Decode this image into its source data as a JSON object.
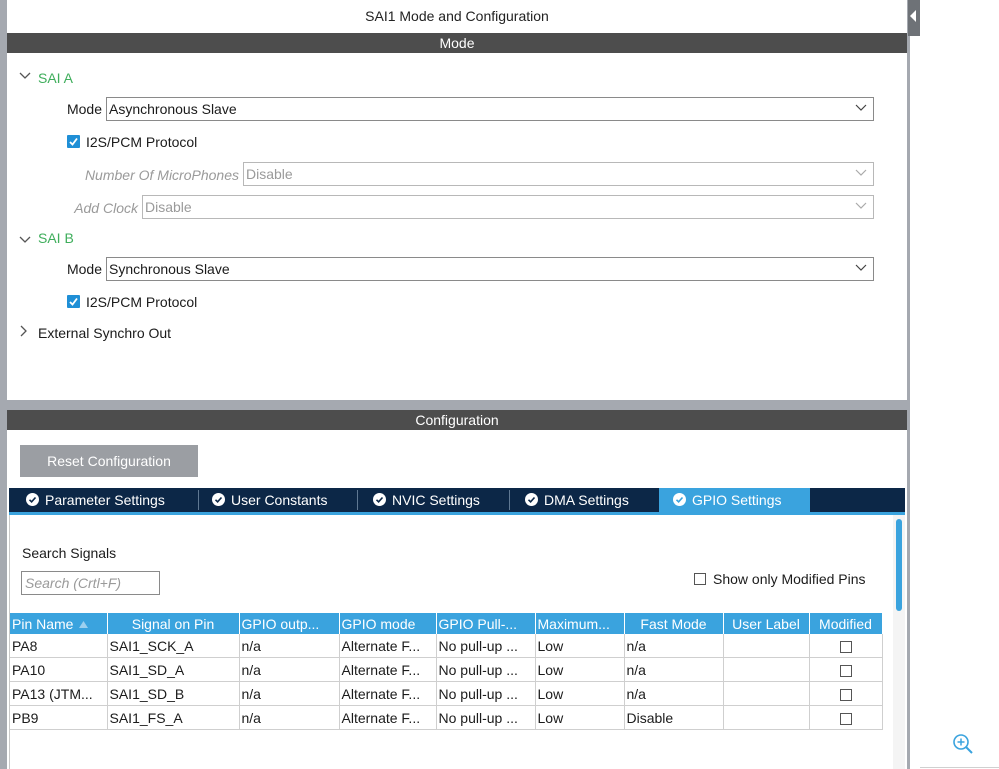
{
  "window": {
    "title": "SAI1 Mode and Configuration"
  },
  "mode_section": {
    "header": "Mode",
    "sai_a": {
      "label": "SAI A",
      "mode_label": "Mode",
      "mode_value": "Asynchronous Slave",
      "protocol_label": "I2S/PCM Protocol",
      "protocol_checked": true,
      "microphones_label": "Number Of MicroPhones",
      "microphones_value": "Disable",
      "add_clock_label": "Add Clock",
      "add_clock_value": "Disable"
    },
    "sai_b": {
      "label": "SAI B",
      "mode_label": "Mode",
      "mode_value": "Synchronous Slave",
      "protocol_label": "I2S/PCM Protocol",
      "protocol_checked": true
    },
    "external_synchro": {
      "label": "External Synchro Out"
    }
  },
  "configuration_section": {
    "header": "Configuration",
    "reset_label": "Reset Configuration",
    "tabs": [
      {
        "label": "Parameter Settings",
        "active": false
      },
      {
        "label": "User Constants",
        "active": false
      },
      {
        "label": "NVIC Settings",
        "active": false
      },
      {
        "label": "DMA Settings",
        "active": false
      },
      {
        "label": "GPIO Settings",
        "active": true
      }
    ],
    "search": {
      "label": "Search Signals",
      "placeholder": "Search (Crtl+F)"
    },
    "show_modified_label": "Show only Modified Pins",
    "table": {
      "columns": [
        "Pin Name",
        "Signal on Pin",
        "GPIO outp...",
        "GPIO mode",
        "GPIO Pull-...",
        "Maximum...",
        "Fast Mode",
        "User Label",
        "Modified"
      ],
      "rows": [
        [
          "PA8",
          "SAI1_SCK_A",
          "n/a",
          "Alternate F...",
          "No pull-up ...",
          "Low",
          "n/a",
          "",
          false
        ],
        [
          "PA10",
          "SAI1_SD_A",
          "n/a",
          "Alternate F...",
          "No pull-up ...",
          "Low",
          "n/a",
          "",
          false
        ],
        [
          "PA13 (JTM...",
          "SAI1_SD_B",
          "n/a",
          "Alternate F...",
          "No pull-up ...",
          "Low",
          "n/a",
          "",
          false
        ],
        [
          "PB9",
          "SAI1_FS_A",
          "n/a",
          "Alternate F...",
          "No pull-up ...",
          "Low",
          "Disable",
          "",
          false
        ]
      ]
    }
  },
  "colors": {
    "accent": "#3aa3de",
    "tab_bar": "#0c2747",
    "band": "#4d4d4d",
    "tree_label": "#3fae5c",
    "button": "#9b9ea3"
  },
  "icons": {
    "collapse": "chevron-down-icon",
    "expand": "chevron-right-icon",
    "tab": "check-circle-icon",
    "zoom": "zoom-in-icon",
    "sort": "sort-up-icon"
  }
}
